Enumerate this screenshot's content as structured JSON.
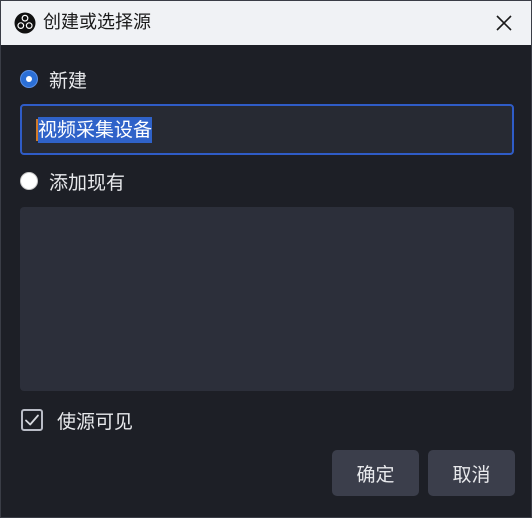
{
  "window": {
    "title": "创建或选择源",
    "app_icon": "obs-logo-icon",
    "close_icon": "close-icon"
  },
  "options": {
    "new_label": "新建",
    "new_selected": true,
    "name_value": "视频采集设备",
    "existing_label": "添加现有",
    "existing_selected": false,
    "existing_items": []
  },
  "visibility": {
    "label": "使源可见",
    "checked": true
  },
  "buttons": {
    "ok_label": "确定",
    "cancel_label": "取消"
  },
  "colors": {
    "accent": "#2f62c9",
    "background": "#1d1f26",
    "list_background": "#2c2f3a",
    "button_background": "#3b3e4b"
  }
}
